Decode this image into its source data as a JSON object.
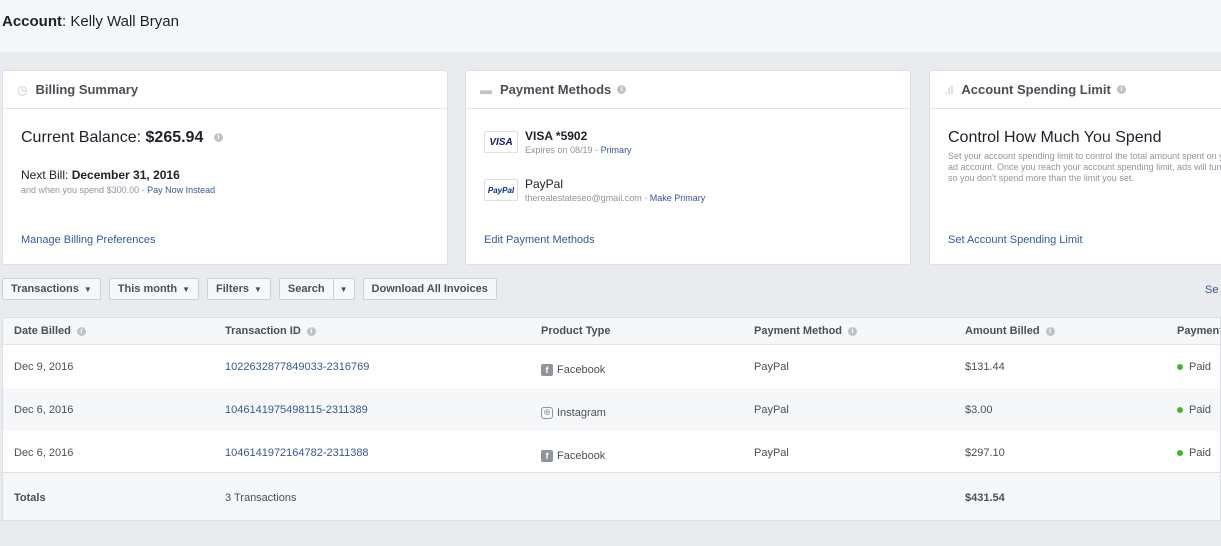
{
  "account": {
    "label": "Account",
    "name": "Kelly Wall Bryan"
  },
  "billing_summary": {
    "title": "Billing Summary",
    "balance_label": "Current Balance:",
    "balance_value": "$265.94",
    "next_bill_label": "Next Bill:",
    "next_bill_date": "December 31, 2016",
    "threshold_text": "and when you spend $300.00 -",
    "pay_now_link": "Pay Now Instead",
    "manage_link": "Manage Billing Preferences"
  },
  "payment_methods": {
    "title": "Payment Methods",
    "methods": [
      {
        "logo": "VISA",
        "name": "VISA *5902",
        "sub": "Expires on 08/19 -",
        "action": "Primary"
      },
      {
        "logo": "PayPal",
        "name": "PayPal",
        "sub": "therealestateseo@gmail.com -",
        "action": "Make Primary"
      }
    ],
    "edit_link": "Edit Payment Methods"
  },
  "spending_limit": {
    "title": "Account Spending Limit",
    "heading": "Control How Much You Spend",
    "description": "Set your account spending limit to control the total amount spent on your ad account. Once you reach your account spending limit, ads will turn off so you don't spend more than the limit you set.",
    "set_link": "Set Account Spending Limit"
  },
  "toolbar": {
    "transactions": "Transactions",
    "period": "This month",
    "filters": "Filters",
    "search": "Search",
    "download": "Download All Invoices",
    "right_link": "Se"
  },
  "table": {
    "headers": [
      "Date Billed",
      "Transaction ID",
      "Product Type",
      "Payment Method",
      "Amount Billed",
      "Payment"
    ],
    "rows": [
      {
        "date": "Dec 9, 2016",
        "txn": "1022632877849033-2316769",
        "product": "Facebook",
        "method": "PayPal",
        "amount": "$131.44",
        "status": "Paid"
      },
      {
        "date": "Dec 6, 2016",
        "txn": "1046141975498115-2311389",
        "product": "Instagram",
        "method": "PayPal",
        "amount": "$3.00",
        "status": "Paid"
      },
      {
        "date": "Dec 6, 2016",
        "txn": "1046141972164782-2311388",
        "product": "Facebook",
        "method": "PayPal",
        "amount": "$297.10",
        "status": "Paid"
      }
    ],
    "totals": {
      "label": "Totals",
      "count": "3 Transactions",
      "amount": "$431.54"
    }
  },
  "colors": {
    "link": "#365899",
    "paid": "#42b72a",
    "background": "#e9ebee"
  },
  "icons": [
    "clock-icon",
    "card-icon",
    "bar-chart-icon",
    "info-icon",
    "facebook-icon",
    "instagram-icon",
    "caret-down-icon"
  ]
}
